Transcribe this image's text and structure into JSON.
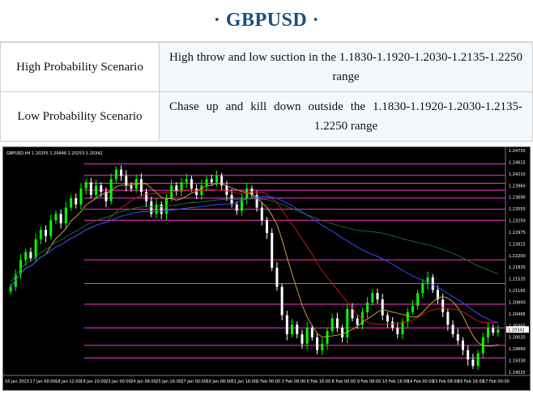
{
  "header": {
    "title": "· GBPUSD ·"
  },
  "scenarios": [
    {
      "label": "High Probability Scenario",
      "text": "High throw and low suction in the 1.1830-1.1920-1.2030-1.2135-1.2250 range"
    },
    {
      "label": "Low Probability Scenario",
      "text": "Chase up and kill down outside the 1.1830-1.1920-1.2030-1.2135-1.2250 range"
    }
  ],
  "chart_data": {
    "type": "candlestick",
    "symbol_header": "GBPUSD,H4  1.20255 1.20446 1.20253 1.20342",
    "colors": {
      "background": "#000000",
      "up": "#00ff00",
      "down": "#ffffff",
      "level_line": "#ff33cc",
      "ma_red": "#c81414",
      "ma_yellow": "#c8a040",
      "ma_blue": "#3050ff",
      "ma_green": "#1a6b2a"
    },
    "price_axis": [
      "1.24735",
      "1.24615",
      "1.24210",
      "1.23960",
      "1.23690",
      "1.23555",
      "1.23250",
      "1.22975",
      "1.22615",
      "1.22200",
      "1.21835",
      "1.21535",
      "1.21165",
      "1.20800",
      "1.20495",
      "1.20355",
      "1.20035",
      "1.19660",
      "1.19330",
      "1.19025"
    ],
    "time_axis": [
      "16 Jan 2023",
      "17 Jan 00:00",
      "18 Jan 12:00",
      "19 Jan 20:00",
      "23 Jan 00:00",
      "24 Jan 08:00",
      "25 Jan 16:00",
      "27 Jan 00:00",
      "30 Jan 08:00",
      "31 Jan 16:00",
      "2 Feb 00:00",
      "3 Feb 08:00",
      "6 Feb 16:00",
      "8 Feb 00:00",
      "9 Feb 08:00",
      "10 Feb 16:00",
      "14 Feb 00:00",
      "15 Feb 08:00",
      "16 Feb 16:00",
      "17 Feb 00:00"
    ],
    "current_price": "1.20342",
    "level_lines": [
      1.2468,
      1.2432,
      1.2407,
      1.2385,
      1.236,
      1.2325,
      1.229,
      1.2165,
      1.209,
      1.2025,
      1.195,
      1.1895,
      1.1855
    ],
    "ylim": [
      1.18,
      1.249
    ],
    "closes": [
      1.208,
      1.212,
      1.2165,
      1.219,
      1.217,
      1.223,
      1.226,
      1.224,
      1.229,
      1.231,
      1.228,
      1.233,
      1.236,
      1.234,
      1.239,
      1.241,
      1.237,
      1.24,
      1.238,
      1.235,
      1.242,
      1.245,
      1.243,
      1.24,
      1.239,
      1.242,
      1.238,
      1.235,
      1.231,
      1.234,
      1.231,
      1.236,
      1.24,
      1.238,
      1.241,
      1.242,
      1.239,
      1.237,
      1.24,
      1.242,
      1.241,
      1.243,
      1.24,
      1.237,
      1.234,
      1.232,
      1.236,
      1.239,
      1.237,
      1.233,
      1.229,
      1.225,
      1.214,
      1.208,
      1.199,
      1.193,
      1.196,
      1.193,
      1.19,
      1.195,
      1.192,
      1.188,
      1.19,
      1.194,
      1.198,
      1.195,
      1.192,
      1.201,
      1.198,
      1.196,
      1.2,
      1.203,
      1.206,
      1.204,
      1.199,
      1.197,
      1.195,
      1.193,
      1.197,
      1.2,
      1.202,
      1.206,
      1.209,
      1.211,
      1.207,
      1.204,
      1.2,
      1.196,
      1.193,
      1.191,
      1.188,
      1.185,
      1.183,
      1.187,
      1.192,
      1.195,
      1.1935,
      1.1945
    ]
  }
}
